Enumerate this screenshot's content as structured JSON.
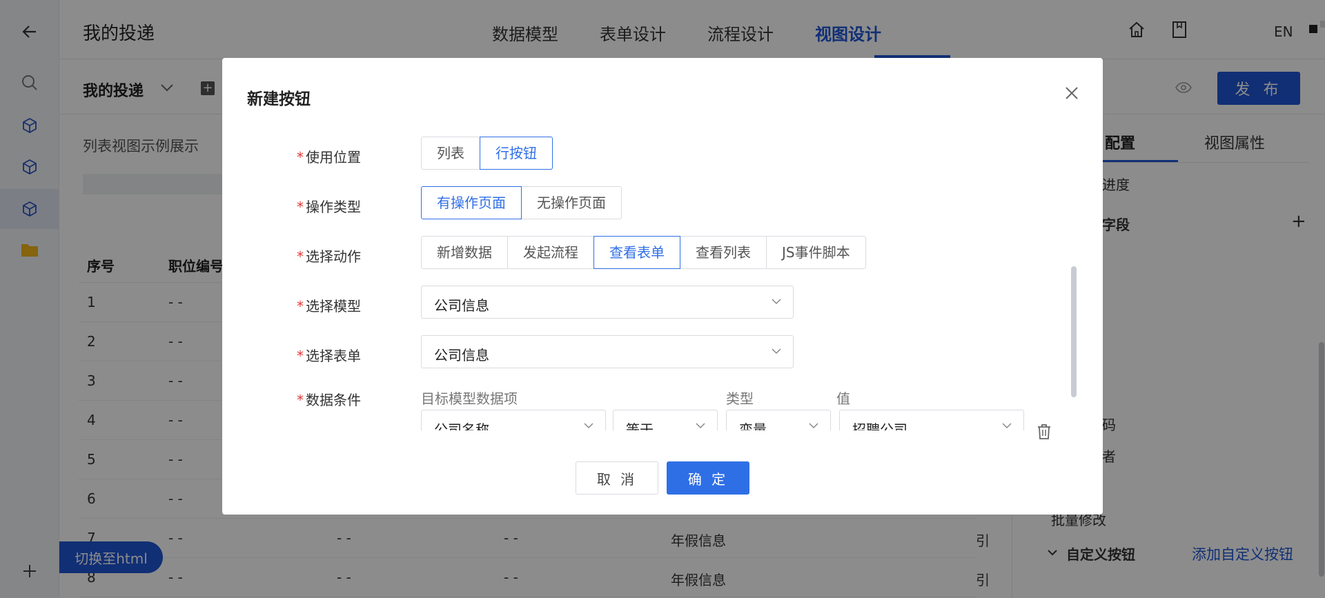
{
  "header": {
    "title": "我的投递",
    "tabs": [
      {
        "label": "数据模型"
      },
      {
        "label": "表单设计"
      },
      {
        "label": "流程设计"
      },
      {
        "label": "视图设计",
        "active": true
      }
    ],
    "lang": "EN",
    "icons": [
      "back-arrow-icon",
      "home-icon",
      "bookmark-icon"
    ]
  },
  "toolbar": {
    "view_name": "我的投递",
    "add_icon": "+",
    "publish_label": "发 布"
  },
  "main": {
    "caption": "列表视图示例展示",
    "columns": [
      "序号",
      "职位编号"
    ],
    "rows": [
      {
        "index": "1",
        "c2": "- -"
      },
      {
        "index": "2",
        "c2": "- -"
      },
      {
        "index": "3",
        "c2": "- -"
      },
      {
        "index": "4",
        "c2": "- -"
      },
      {
        "index": "5",
        "c2": "- -"
      },
      {
        "index": "6",
        "c2": "- -"
      },
      {
        "index": "7",
        "c2": "- -",
        "c3": "- -",
        "c4": "- -",
        "c5": "年假信息",
        "c6": "引"
      },
      {
        "index": "8",
        "c2": "- -",
        "c3": "- -",
        "c4": "- -",
        "c5": "年假信息",
        "c6": "引"
      }
    ]
  },
  "right_panel": {
    "tabs": [
      {
        "label": "配置",
        "active": true
      },
      {
        "label": "视图属性"
      }
    ],
    "items": {
      "progress": "进度",
      "field": "字段",
      "code": "码",
      "author": "者",
      "batch": "批量修改",
      "custom_section": "自定义按钮",
      "add_custom": "添加自定义按钮"
    }
  },
  "switch_label": "切换至html",
  "modal": {
    "title": "新建按钮",
    "fields": {
      "position": {
        "label": "使用位置",
        "options": [
          "列表",
          "行按钮"
        ],
        "selected": "行按钮"
      },
      "op_type": {
        "label": "操作类型",
        "options": [
          "有操作页面",
          "无操作页面"
        ],
        "selected": "有操作页面"
      },
      "action": {
        "label": "选择动作",
        "options": [
          "新增数据",
          "发起流程",
          "查看表单",
          "查看列表",
          "JS事件脚本"
        ],
        "selected": "查看表单"
      },
      "model": {
        "label": "选择模型",
        "value": "公司信息"
      },
      "form": {
        "label": "选择表单",
        "value": "公司信息"
      },
      "condition": {
        "label": "数据条件",
        "headers": [
          "目标模型数据项",
          "类型",
          "值"
        ],
        "row": {
          "field": "公司名称",
          "operator": "等于",
          "type": "变量",
          "value": "招聘公司"
        }
      }
    },
    "cancel_label": "取 消",
    "ok_label": "确 定"
  }
}
